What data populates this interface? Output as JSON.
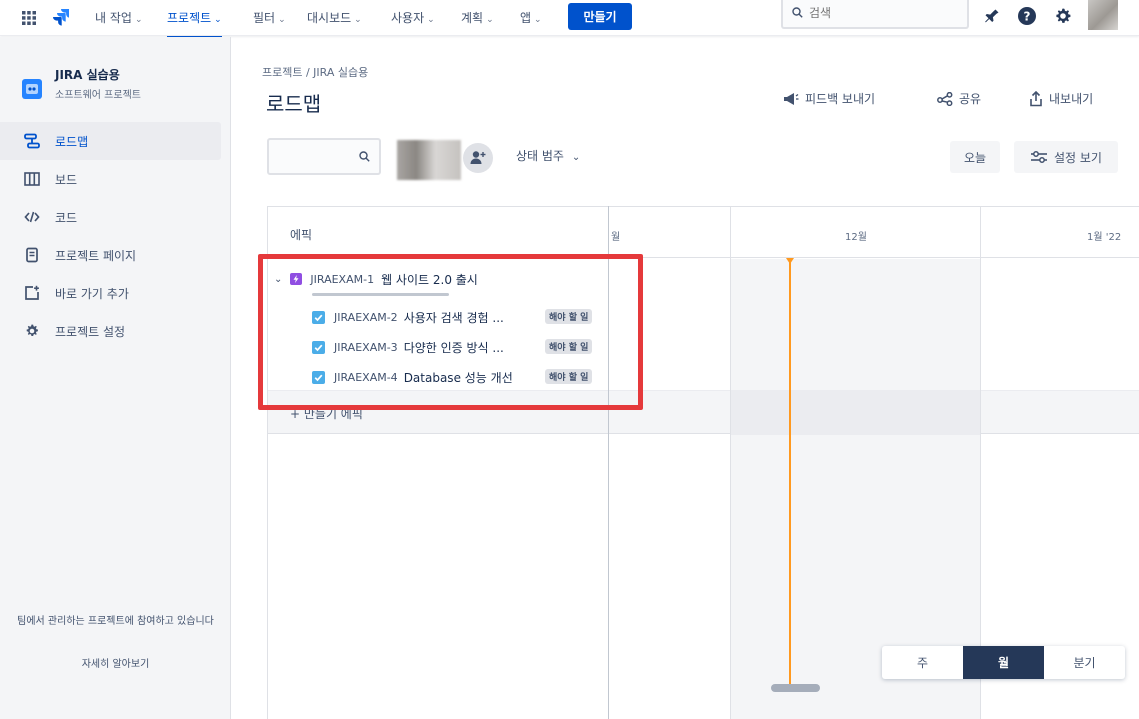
{
  "topnav": {
    "items": [
      {
        "label": "내 작업"
      },
      {
        "label": "프로젝트"
      },
      {
        "label": "필터"
      },
      {
        "label": "대시보드"
      },
      {
        "label": "사용자"
      },
      {
        "label": "계획"
      },
      {
        "label": "앱"
      }
    ],
    "create_label": "만들기",
    "search_placeholder": "검색",
    "icons": [
      "app-switcher-icon",
      "jira-logo",
      "notification-icon",
      "help-icon",
      "settings-icon"
    ]
  },
  "sidebar": {
    "project_name": "JIRA 실습용",
    "project_type": "소프트웨어 프로젝트",
    "items": [
      {
        "label": "로드맵",
        "icon": "roadmap-icon"
      },
      {
        "label": "보드",
        "icon": "board-icon"
      },
      {
        "label": "코드",
        "icon": "code-icon"
      },
      {
        "label": "프로젝트 페이지",
        "icon": "page-icon"
      },
      {
        "label": "바로 가기 추가",
        "icon": "add-shortcut-icon"
      },
      {
        "label": "프로젝트 설정",
        "icon": "settings-icon"
      }
    ],
    "footer_text": "팀에서 관리하는 프로젝트에 참여하고 있습니다",
    "footer_link": "자세히 알아보기"
  },
  "header": {
    "breadcrumb": "프로젝트 / JIRA 실습용",
    "title": "로드맵",
    "actions": {
      "feedback": "피드백 보내기",
      "share": "공유",
      "export": "내보내기"
    }
  },
  "toolbar": {
    "status_filter": "상태 범주",
    "today_label": "오늘",
    "view_settings_label": "설정 보기"
  },
  "timeline": {
    "epic_column_header": "에픽",
    "months": [
      "월",
      "12월",
      "1월 '22"
    ],
    "create_epic_label": "+ 만들기 에픽",
    "scale_options": [
      "주",
      "월",
      "분기"
    ],
    "selected_scale": "월"
  },
  "epics": [
    {
      "key": "JIRAEXAM-1",
      "title": "웹 사이트 2.0 출시",
      "children": [
        {
          "key": "JIRAEXAM-2",
          "title": "사용자 검색 경험 ...",
          "status": "해야 할 일"
        },
        {
          "key": "JIRAEXAM-3",
          "title": "다양한 인증 방식 ...",
          "status": "해야 할 일"
        },
        {
          "key": "JIRAEXAM-4",
          "title": "Database 성능 개선",
          "status": "해야 할 일"
        }
      ]
    }
  ],
  "colors": {
    "brand": "#0052cc",
    "epic": "#904ee2",
    "task": "#4bade8",
    "today_line": "#ff991f",
    "highlight": "#e5393b"
  }
}
